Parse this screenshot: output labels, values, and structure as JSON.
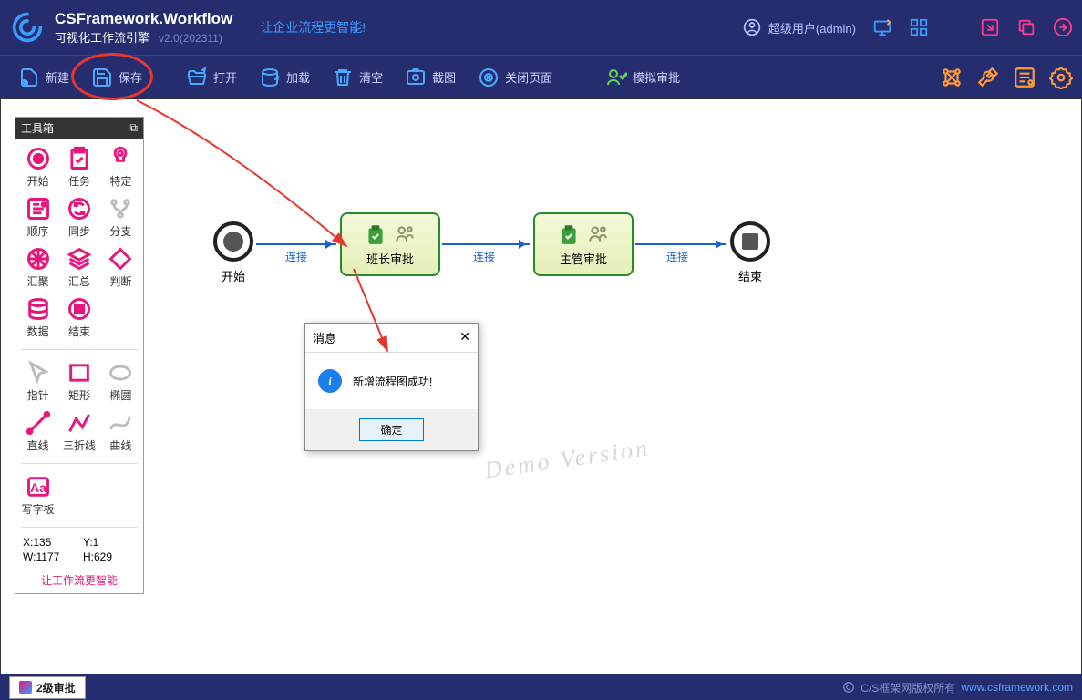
{
  "header": {
    "title_main": "CSFramework.Workflow",
    "title_sub": "可视化工作流引擎",
    "version": "v2.0(202311)",
    "slogan": "让企业流程更智能!",
    "user_label": "超级用户(admin)"
  },
  "toolbar": {
    "items": [
      {
        "id": "new",
        "label": "新建"
      },
      {
        "id": "save",
        "label": "保存"
      },
      {
        "id": "open",
        "label": "打开"
      },
      {
        "id": "load",
        "label": "加载"
      },
      {
        "id": "clear",
        "label": "清空"
      },
      {
        "id": "screenshot",
        "label": "截图"
      },
      {
        "id": "close",
        "label": "关闭页面"
      },
      {
        "id": "simulate",
        "label": "模拟审批"
      }
    ]
  },
  "toolbox": {
    "title": "工具箱",
    "groups": [
      [
        {
          "id": "start",
          "label": "开始"
        },
        {
          "id": "task",
          "label": "任务"
        },
        {
          "id": "special",
          "label": "特定"
        },
        {
          "id": "sequence",
          "label": "顺序"
        },
        {
          "id": "sync",
          "label": "同步"
        },
        {
          "id": "branch",
          "label": "分支"
        },
        {
          "id": "merge",
          "label": "汇聚"
        },
        {
          "id": "summary",
          "label": "汇总"
        },
        {
          "id": "decision",
          "label": "判断"
        },
        {
          "id": "data",
          "label": "数据"
        },
        {
          "id": "end",
          "label": "结束"
        }
      ],
      [
        {
          "id": "pointer",
          "label": "指针"
        },
        {
          "id": "rect",
          "label": "矩形"
        },
        {
          "id": "ellipse",
          "label": "椭圆"
        },
        {
          "id": "line",
          "label": "直线"
        },
        {
          "id": "polyline",
          "label": "三折线"
        },
        {
          "id": "curve",
          "label": "曲线"
        }
      ],
      [
        {
          "id": "textboard",
          "label": "写字板"
        }
      ]
    ],
    "coords": {
      "x_label": "X:135",
      "y_label": "Y:1",
      "w_label": "W:1177",
      "h_label": "H:629"
    },
    "footer": "让工作流更智能"
  },
  "flow": {
    "start_label": "开始",
    "task1_label": "班长审批",
    "task2_label": "主管审批",
    "end_label": "结束",
    "conn_label": "连接"
  },
  "watermark": "Demo Version",
  "dialog": {
    "title": "消息",
    "message": "新增流程图成功!",
    "ok": "确定"
  },
  "statusbar": {
    "tab": "2级审批",
    "copyright": "C/S框架网版权所有",
    "url": "www.csframework.com"
  }
}
